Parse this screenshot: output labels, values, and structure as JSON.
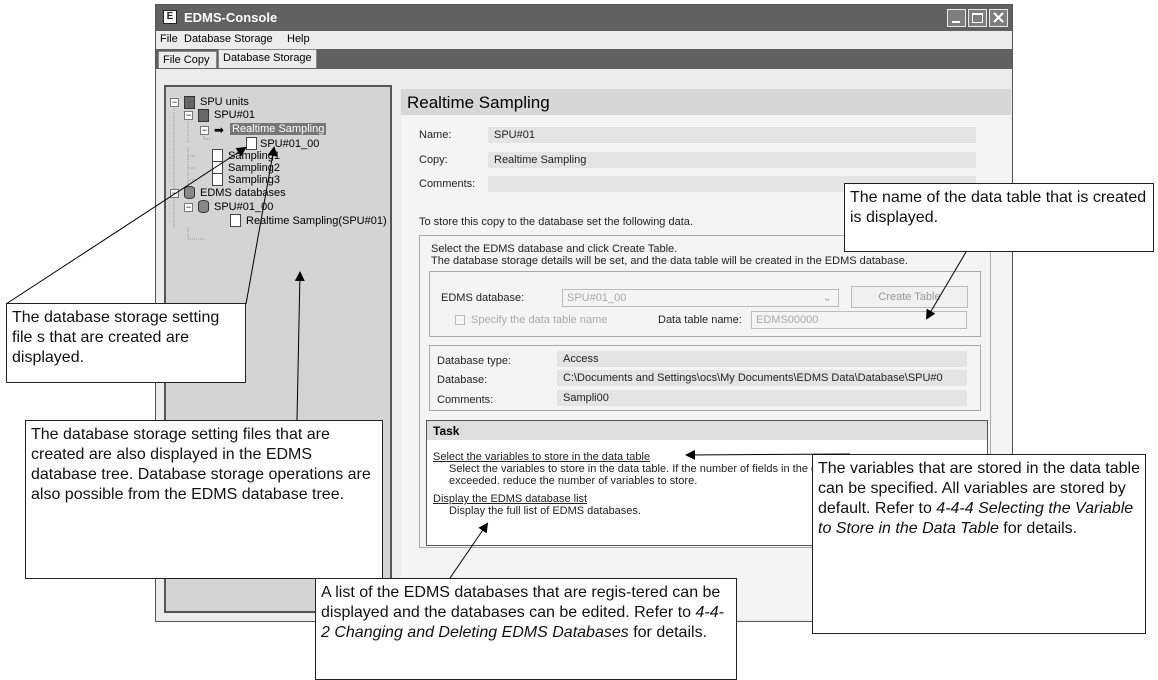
{
  "window": {
    "title": "EDMS-Console",
    "icon_letter": "E"
  },
  "menu": [
    "File",
    "Database Storage",
    "Help"
  ],
  "tabs": [
    "File Copy",
    "Database Storage"
  ],
  "tree": {
    "spu_units": "SPU units",
    "spu01": "SPU#01",
    "realtime": "Realtime Sampling",
    "spu01_00": "SPU#01_00",
    "sampling1": "Sampling1",
    "sampling2": "Sampling2",
    "sampling3": "Sampling3",
    "edms_databases": "EDMS databases",
    "db_spu01_00": "SPU#01_00",
    "db_realtime": "Realtime Sampling(SPU#01)"
  },
  "panel": {
    "title": "Realtime Sampling",
    "name_label": "Name:",
    "name_value": "SPU#01",
    "copy_label": "Copy:",
    "copy_value": "Realtime Sampling",
    "comments_label": "Comments:",
    "comments_value": "",
    "instruction": "To store this copy to the database set the following data.",
    "select_line1": "Select the EDMS database and click Create Table.",
    "select_line2": "The database storage details will be set, and the data table will be created in the EDMS database.",
    "edms_db_label": "EDMS database:",
    "edms_db_value": "SPU#01_00",
    "create_table": "Create Table",
    "specify_checkbox": "Specify the data table name",
    "data_table_label": "Data table name:",
    "data_table_value": "EDMS00000",
    "db_type_label": "Database type:",
    "db_type_value": "Access",
    "database_label": "Database:",
    "database_value": "C:\\Documents and Settings\\ocs\\My Documents\\EDMS Data\\Database\\SPU#0",
    "db_comments_label": "Comments:",
    "db_comments_value": "Sampli00"
  },
  "task": {
    "title": "Task",
    "link1": "Select the variables to store in the data table",
    "desc1a": "Select the variables to store in the data table. If the number of fields in the data table is",
    "desc1b": "exceeded. reduce the number of variables to store.",
    "link2": "Display the EDMS database list",
    "desc2": "Display the full list of EDMS databases."
  },
  "callouts": {
    "c1": "The database storage setting file s that are created are displayed.",
    "c2": "The database storage setting files that are created are also displayed in the EDMS database tree. Database storage operations are also possible from the EDMS database tree.",
    "c3": "The name of the data table that is created is displayed.",
    "c4_a": "The variables that are stored in the data table can be specified. All variables are stored by default. Refer to ",
    "c4_i1": "4-4-4 Selecting the Variable to Store in the Data Table",
    "c4_b": " for details.",
    "c5_a": "A list of the EDMS databases that are regis-tered can be displayed and the databases can be edited. Refer to ",
    "c5_i1": "4-4-2 Changing and Deleting EDMS Databases",
    "c5_b": " for details."
  }
}
